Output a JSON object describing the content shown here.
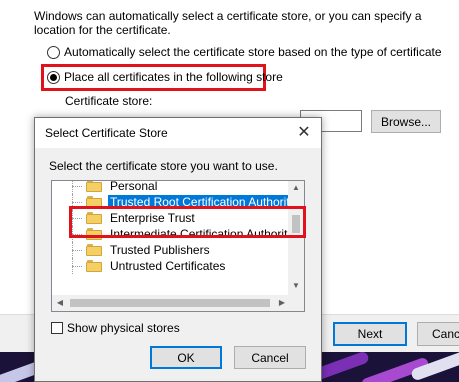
{
  "wizard": {
    "description": "Windows can automatically select a certificate store, or you can specify a location for the certificate.",
    "option_auto": "Automatically select the certificate store based on the type of certificate",
    "option_manual": "Place all certificates in the following store",
    "store_label": "Certificate store:",
    "browse_button": "Browse...",
    "next_button": "Next",
    "cancel_button": "Canc"
  },
  "dialog": {
    "title": "Select Certificate Store",
    "prompt": "Select the certificate store you want to use.",
    "stores": [
      {
        "label": "Personal",
        "selected": false
      },
      {
        "label": "Trusted Root Certification Authorities",
        "selected": true
      },
      {
        "label": "Enterprise Trust",
        "selected": false
      },
      {
        "label": "Intermediate Certification Authorities",
        "selected": false
      },
      {
        "label": "Trusted Publishers",
        "selected": false
      },
      {
        "label": "Untrusted Certificates",
        "selected": false
      }
    ],
    "show_physical_label": "Show physical stores",
    "show_physical_checked": false,
    "ok_button": "OK",
    "cancel_button": "Cancel"
  },
  "colors": {
    "highlight": "#e0121c",
    "selection": "#0078d7"
  }
}
